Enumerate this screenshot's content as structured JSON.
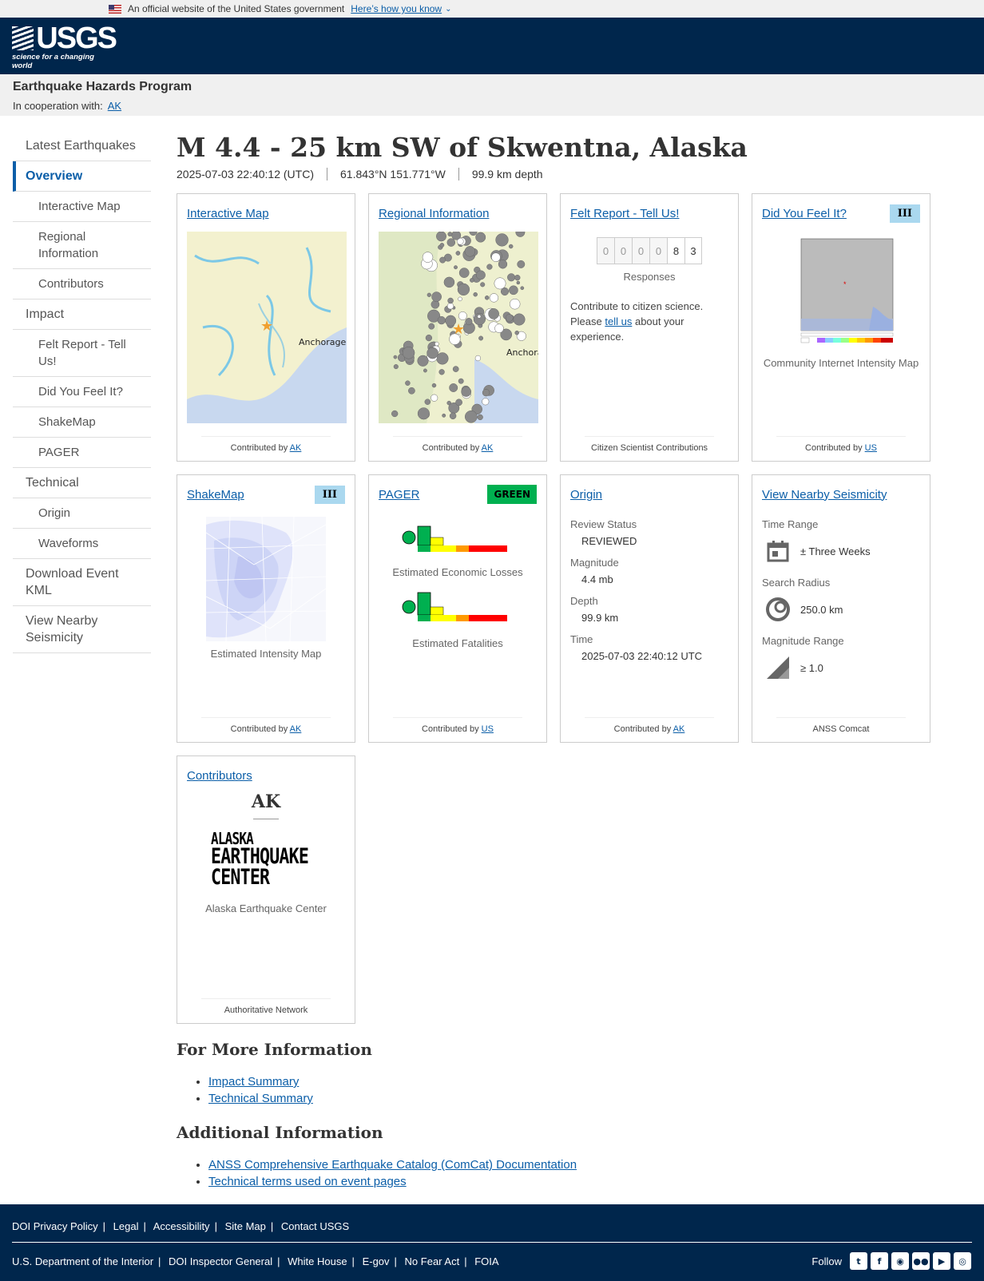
{
  "gov": {
    "text": "An official website of the United States government",
    "link": "Here’s how you know"
  },
  "logo": {
    "word": "USGS",
    "tagline": "science for a changing world"
  },
  "program": {
    "title": "Earthquake Hazards Program",
    "coop": "In cooperation with:",
    "coop_link": "AK"
  },
  "nav": [
    {
      "label": "Latest Earthquakes"
    },
    {
      "label": "Overview"
    },
    {
      "label": "Interactive Map"
    },
    {
      "label": "Regional Information"
    },
    {
      "label": "Contributors"
    },
    {
      "label": "Impact"
    },
    {
      "label": "Felt Report - Tell Us!"
    },
    {
      "label": "Did You Feel It?"
    },
    {
      "label": "ShakeMap"
    },
    {
      "label": "PAGER"
    },
    {
      "label": "Technical"
    },
    {
      "label": "Origin"
    },
    {
      "label": "Waveforms"
    },
    {
      "label": "Download Event KML"
    },
    {
      "label": "View Nearby Seismicity"
    }
  ],
  "event": {
    "title": "M 4.4 - 25 km SW of Skwentna, Alaska",
    "time": "2025-07-03 22:40:12 (UTC)",
    "coords": "61.843°N 151.771°W",
    "depth": "99.9 km depth"
  },
  "cards": {
    "imap": {
      "title": "Interactive Map",
      "contrib": "Contributed by",
      "net": "AK",
      "city": "Anchorage"
    },
    "regional": {
      "title": "Regional Information",
      "contrib": "Contributed by",
      "net": "AK",
      "city": "Anchorag"
    },
    "felt": {
      "title": "Felt Report - Tell Us!",
      "digits": [
        "0",
        "0",
        "0",
        "0",
        "8",
        "3"
      ],
      "responses": "Responses",
      "text1": "Contribute to citizen science. Please",
      "link": "tell us",
      "text2": "about your experience.",
      "foot": "Citizen Scientist Contributions"
    },
    "dyfi": {
      "title": "Did You Feel It?",
      "badge": "III",
      "caption": "Community Internet Intensity Map",
      "contrib": "Contributed by",
      "net": "US"
    },
    "shakemap": {
      "title": "ShakeMap",
      "badge": "III",
      "caption": "Estimated Intensity Map",
      "contrib": "Contributed by",
      "net": "AK"
    },
    "pager": {
      "title": "PAGER",
      "badge": "GREEN",
      "econ": "Estimated Economic Losses",
      "fatal": "Estimated Fatalities",
      "contrib": "Contributed by",
      "net": "US"
    },
    "origin": {
      "title": "Origin",
      "fields": [
        {
          "k": "Review Status",
          "v": "REVIEWED"
        },
        {
          "k": "Magnitude",
          "v": "4.4 mb"
        },
        {
          "k": "Depth",
          "v": "99.9 km"
        },
        {
          "k": "Time",
          "v": "2025-07-03 22:40:12 UTC"
        }
      ],
      "contrib": "Contributed by",
      "net": "AK"
    },
    "nearby": {
      "title": "View Nearby Seismicity",
      "time_label": "Time Range",
      "time_val": "± Three Weeks",
      "radius_label": "Search Radius",
      "radius_val": "250.0 km",
      "mag_label": "Magnitude Range",
      "mag_val": "≥ 1.0",
      "foot": "ANSS Comcat"
    },
    "contributors": {
      "title": "Contributors",
      "net": "AK",
      "logo1": "ALASKA",
      "logo2": "EARTHQUAKE",
      "logo3": "CENTER",
      "name": "Alaska Earthquake Center",
      "foot": "Authoritative Network"
    }
  },
  "more": {
    "title": "For More Information",
    "links": [
      "Impact Summary",
      "Technical Summary"
    ]
  },
  "additional": {
    "title": "Additional Information",
    "links": [
      "ANSS Comprehensive Earthquake Catalog (ComCat) Documentation",
      "Technical terms used on event pages"
    ]
  },
  "footer": {
    "row1": [
      "DOI Privacy Policy",
      "Legal",
      "Accessibility",
      "Site Map",
      "Contact USGS"
    ],
    "row2": [
      "U.S. Department of the Interior",
      "DOI Inspector General",
      "White House",
      "E-gov",
      "No Fear Act",
      "FOIA"
    ],
    "follow": "Follow"
  }
}
